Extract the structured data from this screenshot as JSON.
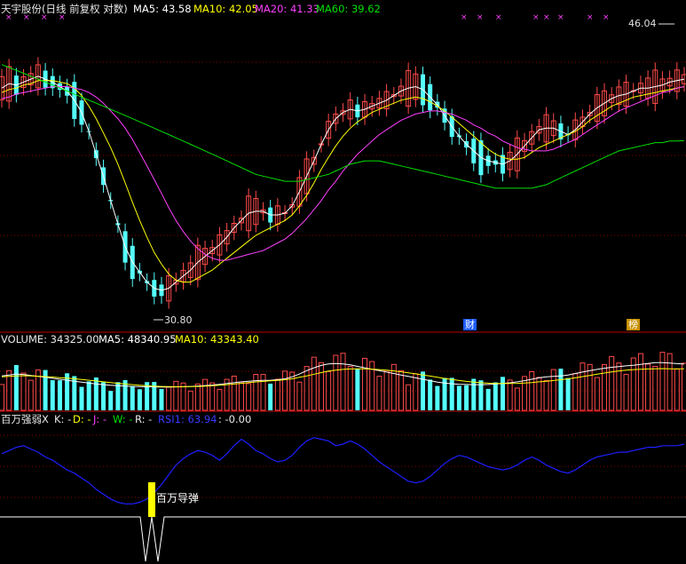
{
  "header": {
    "title": "天宇股份(日线 前复权 对数)",
    "ma5": "MA5: 43.58",
    "ma10": "MA10: 42.05",
    "ma20": "MA20: 41.33",
    "ma60": "MA60: 39.62"
  },
  "price_panel": {
    "high_label": "46.04",
    "low_label": "30.80",
    "event_tags": [
      "财",
      "榜"
    ]
  },
  "volume_panel": {
    "volume": "VOLUME: 34325.00",
    "ma5": "MA5: 48340.95",
    "ma10": "MA10: 43343.40"
  },
  "indicator_panel": {
    "name": "百万强弱X",
    "k": "K: -",
    "d": "D: -",
    "j": "J: -",
    "w": "W: -",
    "r": "R: -",
    "rsi": "RSI1: 63.94",
    "extra": ": -0.00",
    "signal_label": "百万导弹"
  },
  "colors": {
    "up": "#ff4a4a",
    "down": "#54ffff",
    "ma5": "#ffffff",
    "ma10": "#ffff00",
    "ma20": "#ff40ff",
    "ma60": "#00e000",
    "rsi_line": "#1e1eff",
    "divider": "#c00000",
    "signal": "#ffff00"
  },
  "chart_data": [
    {
      "type": "candlestick",
      "title": "天宇股份(日线 前复权 对数)",
      "y_scale": "log",
      "ylim": [
        29.5,
        48.5
      ],
      "series": [
        {
          "name": "MA5",
          "values": [
            43.0,
            43.3,
            43.2,
            43.4,
            43.6,
            43.8,
            43.6,
            43.4,
            43.1,
            42.8,
            42.2,
            41.4,
            40.2,
            38.8,
            37.5,
            36.1,
            34.8,
            33.6,
            32.8,
            32.3,
            31.8,
            31.5,
            31.4,
            31.5,
            31.8,
            32.1,
            32.4,
            32.8,
            33.1,
            33.4,
            33.7,
            34.1,
            34.6,
            35.0,
            35.4,
            35.5,
            35.5,
            35.3,
            35.3,
            35.4,
            35.8,
            36.6,
            37.5,
            38.4,
            39.4,
            40.3,
            41.0,
            41.4,
            41.6,
            41.5,
            41.6,
            41.8,
            42.0,
            42.2,
            42.5,
            42.8,
            43.0,
            43.1,
            42.9,
            42.4,
            41.9,
            41.2,
            40.5,
            39.9,
            39.4,
            39.0,
            38.6,
            38.4,
            38.3,
            38.2,
            38.4,
            38.8,
            39.3,
            39.8,
            40.3,
            40.4,
            40.4,
            40.2,
            40.0,
            40.3,
            40.8,
            41.3,
            41.7,
            42.0,
            42.3,
            42.5,
            42.6,
            42.8,
            43.0,
            43.0,
            43.1,
            43.2,
            43.4,
            43.5,
            43.6
          ]
        },
        {
          "name": "MA10",
          "values": [
            42.7,
            42.9,
            43.0,
            43.2,
            43.3,
            43.5,
            43.5,
            43.5,
            43.4,
            43.3,
            43.0,
            42.5,
            41.8,
            41.0,
            40.1,
            39.2,
            38.2,
            37.1,
            36.0,
            35.0,
            34.1,
            33.3,
            32.7,
            32.2,
            31.9,
            31.8,
            31.8,
            32.0,
            32.2,
            32.4,
            32.7,
            33.0,
            33.3,
            33.6,
            33.9,
            34.2,
            34.4,
            34.6,
            34.8,
            35.0,
            35.3,
            35.8,
            36.4,
            37.1,
            37.9,
            38.6,
            39.3,
            39.9,
            40.4,
            40.8,
            41.1,
            41.4,
            41.6,
            41.8,
            42.0,
            42.2,
            42.3,
            42.4,
            42.3,
            42.1,
            41.8,
            41.5,
            41.1,
            40.7,
            40.3,
            39.9,
            39.5,
            39.1,
            38.8,
            38.6,
            38.5,
            38.5,
            38.6,
            38.9,
            39.2,
            39.4,
            39.6,
            39.8,
            40.0,
            40.2,
            40.5,
            40.9,
            41.2,
            41.5,
            41.8,
            42.0,
            42.2,
            42.4,
            42.5,
            42.6,
            42.7,
            42.8,
            42.9,
            43.0,
            43.1
          ]
        },
        {
          "name": "MA20",
          "values": [
            42.3,
            42.4,
            42.6,
            42.7,
            42.8,
            42.9,
            43.0,
            43.1,
            43.1,
            43.1,
            43.0,
            42.9,
            42.7,
            42.4,
            42.0,
            41.5,
            41.0,
            40.4,
            39.7,
            38.9,
            38.1,
            37.3,
            36.5,
            35.7,
            35.0,
            34.4,
            33.9,
            33.5,
            33.2,
            33.0,
            32.9,
            32.9,
            33.0,
            33.1,
            33.2,
            33.3,
            33.4,
            33.6,
            33.8,
            34.0,
            34.3,
            34.7,
            35.1,
            35.6,
            36.1,
            36.7,
            37.2,
            37.8,
            38.3,
            38.8,
            39.2,
            39.6,
            40.0,
            40.3,
            40.6,
            40.9,
            41.1,
            41.3,
            41.4,
            41.5,
            41.5,
            41.4,
            41.3,
            41.1,
            40.9,
            40.6,
            40.4,
            40.1,
            39.9,
            39.6,
            39.4,
            39.2,
            39.1,
            39.0,
            39.0,
            39.0,
            39.1,
            39.3,
            39.5,
            39.7,
            40.0,
            40.3,
            40.6,
            40.9,
            41.2,
            41.5,
            41.7,
            41.9,
            42.1,
            42.3,
            42.5,
            42.7,
            42.8,
            43.0,
            43.1
          ]
        },
        {
          "name": "MA60",
          "values": [
            44.6,
            44.4,
            44.2,
            44.0,
            43.8,
            43.6,
            43.4,
            43.2,
            43.0,
            42.8,
            42.6,
            42.4,
            42.2,
            42.0,
            41.8,
            41.6,
            41.4,
            41.2,
            41.0,
            40.8,
            40.6,
            40.4,
            40.2,
            40.0,
            39.8,
            39.6,
            39.4,
            39.2,
            39.0,
            38.8,
            38.6,
            38.4,
            38.2,
            38.0,
            37.8,
            37.6,
            37.5,
            37.4,
            37.3,
            37.2,
            37.2,
            37.2,
            37.3,
            37.4,
            37.5,
            37.6,
            37.8,
            38.0,
            38.2,
            38.3,
            38.4,
            38.4,
            38.4,
            38.3,
            38.2,
            38.1,
            38.0,
            37.9,
            37.8,
            37.7,
            37.6,
            37.5,
            37.4,
            37.3,
            37.2,
            37.1,
            37.0,
            36.9,
            36.8,
            36.8,
            36.8,
            36.8,
            36.8,
            36.8,
            36.9,
            37.0,
            37.2,
            37.4,
            37.6,
            37.8,
            38.0,
            38.2,
            38.4,
            38.6,
            38.8,
            39.0,
            39.1,
            39.2,
            39.3,
            39.4,
            39.5,
            39.5,
            39.6,
            39.6,
            39.62
          ]
        }
      ],
      "annotations": [
        {
          "text": "46.04",
          "value": 46.04
        },
        {
          "text": "30.80",
          "value": 30.8
        }
      ]
    },
    {
      "type": "bar",
      "title": "VOLUME",
      "series": [
        {
          "name": "MA5",
          "values": [
            36000,
            37000,
            38000,
            37500,
            36500,
            35500,
            34500,
            33500,
            32500,
            31500,
            30500,
            29500,
            28500,
            27500,
            26800,
            26200,
            25800,
            25400,
            25000,
            24800,
            24600,
            24500,
            24400,
            24400,
            24500,
            24700,
            25000,
            25400,
            25900,
            26500,
            27200,
            28000,
            28900,
            29800,
            30500,
            31000,
            31300,
            31500,
            32000,
            33000,
            35000,
            38000,
            41500,
            44500,
            47000,
            48500,
            49000,
            48500,
            47500,
            46000,
            44500,
            43000,
            41500,
            40000,
            38500,
            37000,
            35500,
            34000,
            32500,
            31000,
            29500,
            28500,
            27800,
            27300,
            27000,
            26800,
            26800,
            27000,
            27500,
            28000,
            28800,
            29800,
            31000,
            32500,
            34000,
            35000,
            35500,
            36000,
            37000,
            38500,
            40000,
            41500,
            42800,
            44000,
            45000,
            45800,
            46500,
            47200,
            48000,
            49000,
            50000,
            50000,
            49500,
            48800,
            48340.95
          ]
        },
        {
          "name": "MA10",
          "values": [
            35000,
            35500,
            36000,
            36200,
            36000,
            35700,
            35300,
            34800,
            34200,
            33600,
            33000,
            32300,
            31500,
            30700,
            29800,
            29000,
            28200,
            27500,
            26800,
            26200,
            25700,
            25300,
            25000,
            24800,
            24700,
            24700,
            24800,
            25000,
            25300,
            25700,
            26200,
            26800,
            27500,
            28200,
            29000,
            29700,
            30300,
            30800,
            31300,
            32000,
            33000,
            34500,
            36000,
            37800,
            39500,
            41000,
            42000,
            42800,
            43300,
            43500,
            43400,
            43100,
            42600,
            42000,
            41200,
            40300,
            39300,
            38200,
            37000,
            35800,
            34500,
            33300,
            32200,
            31200,
            30300,
            29500,
            28900,
            28400,
            28100,
            28000,
            28000,
            28200,
            28600,
            29100,
            29800,
            30500,
            31200,
            32000,
            33000,
            34000,
            35300,
            36500,
            37800,
            39000,
            40200,
            41200,
            42000,
            42600,
            43000,
            43300,
            43500,
            43600,
            43500,
            43400,
            43343.4
          ]
        }
      ]
    },
    {
      "type": "line",
      "title": "百万强弱X",
      "series": [
        {
          "name": "RSI1",
          "values": [
            58,
            60,
            62,
            63,
            61,
            59,
            56,
            54,
            51,
            48,
            46,
            43,
            40,
            36,
            33,
            30,
            28,
            27,
            27,
            28,
            30,
            34,
            39,
            45,
            51,
            55,
            58,
            60,
            59,
            57,
            54,
            58,
            63,
            67,
            64,
            60,
            58,
            55,
            53,
            54,
            57,
            62,
            66,
            68,
            67,
            66,
            63,
            64,
            66,
            64,
            61,
            57,
            53,
            50,
            47,
            44,
            41,
            40,
            41,
            44,
            48,
            52,
            55,
            57,
            56,
            54,
            52,
            50,
            49,
            48,
            49,
            51,
            54,
            56,
            54,
            51,
            49,
            47,
            46,
            48,
            51,
            54,
            56,
            57,
            58,
            59,
            59,
            60,
            61,
            62,
            62,
            63,
            63,
            63,
            63.94
          ]
        }
      ],
      "annotations": [
        {
          "text": "百万导弹"
        }
      ]
    }
  ]
}
